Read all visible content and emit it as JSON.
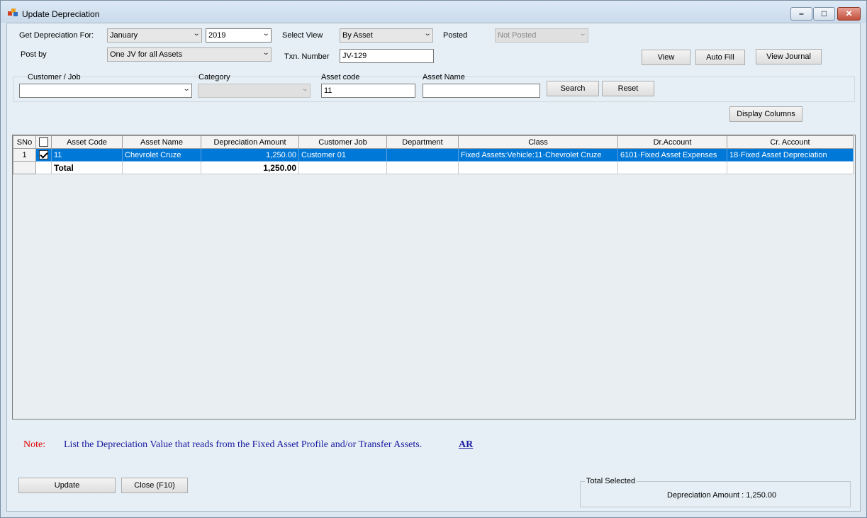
{
  "window": {
    "title": "Update Depreciation"
  },
  "filters": {
    "get_depreciation_for_label": "Get Depreciation For:",
    "month": "January",
    "year": "2019",
    "select_view_label": "Select View",
    "view": "By Asset",
    "posted_label": "Posted",
    "posted_value": "Not Posted",
    "post_by_label": "Post by",
    "post_by_value": "One JV for all Assets",
    "txn_number_label": "Txn. Number",
    "txn_number_value": "JV-129",
    "customer_job_label": "Customer / Job",
    "customer_job_value": "",
    "category_label": "Category",
    "category_value": "",
    "asset_code_label": "Asset code",
    "asset_code_value": "11",
    "asset_name_label": "Asset Name",
    "asset_name_value": ""
  },
  "buttons": {
    "view": "View",
    "auto_fill": "Auto Fill",
    "view_journal": "View Journal",
    "search": "Search",
    "reset": "Reset",
    "display_columns": "Display Columns",
    "update": "Update",
    "close": "Close (F10)"
  },
  "grid": {
    "columns": [
      "SNo",
      "",
      "Asset Code",
      "Asset Name",
      "Depreciation Amount",
      "Customer Job",
      "Department",
      "Class",
      "Dr.Account",
      "Cr. Account"
    ],
    "rows": [
      {
        "sno": "1",
        "checked": true,
        "asset_code": "11",
        "asset_name": "Chevrolet Cruze",
        "depreciation_amount": "1,250.00",
        "customer_job": "Customer 01",
        "department": "",
        "class": "Fixed Assets:Vehicle:11·Chevrolet Cruze",
        "dr_account": "6101·Fixed Asset Expenses",
        "cr_account": "18·Fixed Asset Depreciation"
      }
    ],
    "total_label": "Total",
    "total_amount": "1,250.00"
  },
  "note": {
    "label": "Note:",
    "text": "List the Depreciation Value that reads from the Fixed Asset Profile and/or Transfer Assets.",
    "link": "AR"
  },
  "total_selected": {
    "legend": "Total Selected",
    "text": "Depreciation Amount : 1,250.00"
  },
  "colors": {
    "selection": "#0078d7",
    "note_label": "#e00000",
    "note_text": "#1a1aa0"
  }
}
